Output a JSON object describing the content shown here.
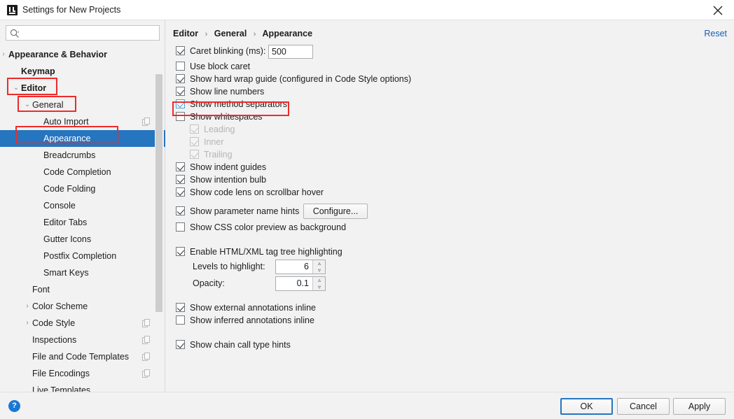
{
  "window": {
    "title": "Settings for New Projects",
    "app_icon": "intellij-idea-icon",
    "close_icon": "close-icon"
  },
  "sidebar": {
    "search": {
      "placeholder": "",
      "value": "",
      "icon": "search-icon"
    },
    "items": [
      {
        "label": "Appearance & Behavior",
        "indent": 12,
        "arrow": "›",
        "bold": true,
        "selected": false,
        "copy": false
      },
      {
        "label": "Keymap",
        "indent": 30,
        "arrow": "",
        "bold": true,
        "selected": false,
        "copy": false
      },
      {
        "label": "Editor",
        "indent": 30,
        "arrow": "⌄",
        "bold": true,
        "selected": false,
        "copy": false
      },
      {
        "label": "General",
        "indent": 46,
        "arrow": "⌄",
        "bold": false,
        "selected": false,
        "copy": false
      },
      {
        "label": "Auto Import",
        "indent": 62,
        "arrow": "",
        "bold": false,
        "selected": false,
        "copy": true
      },
      {
        "label": "Appearance",
        "indent": 62,
        "arrow": "",
        "bold": false,
        "selected": true,
        "copy": false
      },
      {
        "label": "Breadcrumbs",
        "indent": 62,
        "arrow": "",
        "bold": false,
        "selected": false,
        "copy": false
      },
      {
        "label": "Code Completion",
        "indent": 62,
        "arrow": "",
        "bold": false,
        "selected": false,
        "copy": false
      },
      {
        "label": "Code Folding",
        "indent": 62,
        "arrow": "",
        "bold": false,
        "selected": false,
        "copy": false
      },
      {
        "label": "Console",
        "indent": 62,
        "arrow": "",
        "bold": false,
        "selected": false,
        "copy": false
      },
      {
        "label": "Editor Tabs",
        "indent": 62,
        "arrow": "",
        "bold": false,
        "selected": false,
        "copy": false
      },
      {
        "label": "Gutter Icons",
        "indent": 62,
        "arrow": "",
        "bold": false,
        "selected": false,
        "copy": false
      },
      {
        "label": "Postfix Completion",
        "indent": 62,
        "arrow": "",
        "bold": false,
        "selected": false,
        "copy": false
      },
      {
        "label": "Smart Keys",
        "indent": 62,
        "arrow": "",
        "bold": false,
        "selected": false,
        "copy": false
      },
      {
        "label": "Font",
        "indent": 46,
        "arrow": "",
        "bold": false,
        "selected": false,
        "copy": false
      },
      {
        "label": "Color Scheme",
        "indent": 46,
        "arrow": "›",
        "bold": false,
        "selected": false,
        "copy": false
      },
      {
        "label": "Code Style",
        "indent": 46,
        "arrow": "›",
        "bold": false,
        "selected": false,
        "copy": true
      },
      {
        "label": "Inspections",
        "indent": 46,
        "arrow": "",
        "bold": false,
        "selected": false,
        "copy": true
      },
      {
        "label": "File and Code Templates",
        "indent": 46,
        "arrow": "",
        "bold": false,
        "selected": false,
        "copy": true
      },
      {
        "label": "File Encodings",
        "indent": 46,
        "arrow": "",
        "bold": false,
        "selected": false,
        "copy": true
      },
      {
        "label": "Live Templates",
        "indent": 46,
        "arrow": "",
        "bold": false,
        "selected": false,
        "copy": false
      }
    ]
  },
  "main": {
    "breadcrumb": [
      "Editor",
      "General",
      "Appearance"
    ],
    "breadcrumb_separator": "›",
    "reset_label": "Reset",
    "caret_blinking": {
      "label": "Caret blinking (ms):",
      "checked": true,
      "value": "500"
    },
    "options": [
      {
        "label": "Use block caret",
        "checked": false,
        "disabled": false,
        "accent": false
      },
      {
        "label": "Show hard wrap guide (configured in Code Style options)",
        "checked": true,
        "disabled": false,
        "accent": false
      },
      {
        "label": "Show line numbers",
        "checked": true,
        "disabled": false,
        "accent": false
      },
      {
        "label": "Show method separators",
        "checked": true,
        "disabled": false,
        "accent": true
      },
      {
        "label": "Show whitespaces",
        "checked": false,
        "disabled": false,
        "accent": false
      }
    ],
    "whitespace_suboptions": [
      {
        "label": "Leading",
        "checked": true,
        "disabled": true
      },
      {
        "label": "Inner",
        "checked": true,
        "disabled": true
      },
      {
        "label": "Trailing",
        "checked": true,
        "disabled": true
      }
    ],
    "options2": [
      {
        "label": "Show indent guides",
        "checked": true
      },
      {
        "label": "Show intention bulb",
        "checked": true
      },
      {
        "label": "Show code lens on scrollbar hover",
        "checked": true
      }
    ],
    "param_hints": {
      "label": "Show parameter name hints",
      "checked": true,
      "button_label": "Configure..."
    },
    "css_preview": {
      "label": "Show CSS color preview as background",
      "checked": false
    },
    "html_xml": {
      "label": "Enable HTML/XML tag tree highlighting",
      "checked": true,
      "levels_label": "Levels to highlight:",
      "levels_value": "6",
      "opacity_label": "Opacity:",
      "opacity_value": "0.1"
    },
    "annotations": [
      {
        "label": "Show external annotations inline",
        "checked": true
      },
      {
        "label": "Show inferred annotations inline",
        "checked": false
      }
    ],
    "chain_hints": {
      "label": "Show chain call type hints",
      "checked": true
    }
  },
  "footer": {
    "help_icon": "?",
    "ok_label": "OK",
    "cancel_label": "Cancel",
    "apply_label": "Apply"
  },
  "colors": {
    "selection_blue": "#2675bf",
    "link_blue": "#1a5fb4",
    "annotation_red": "#ee2b2b",
    "accent_checkbox": "#3d9ad4"
  }
}
